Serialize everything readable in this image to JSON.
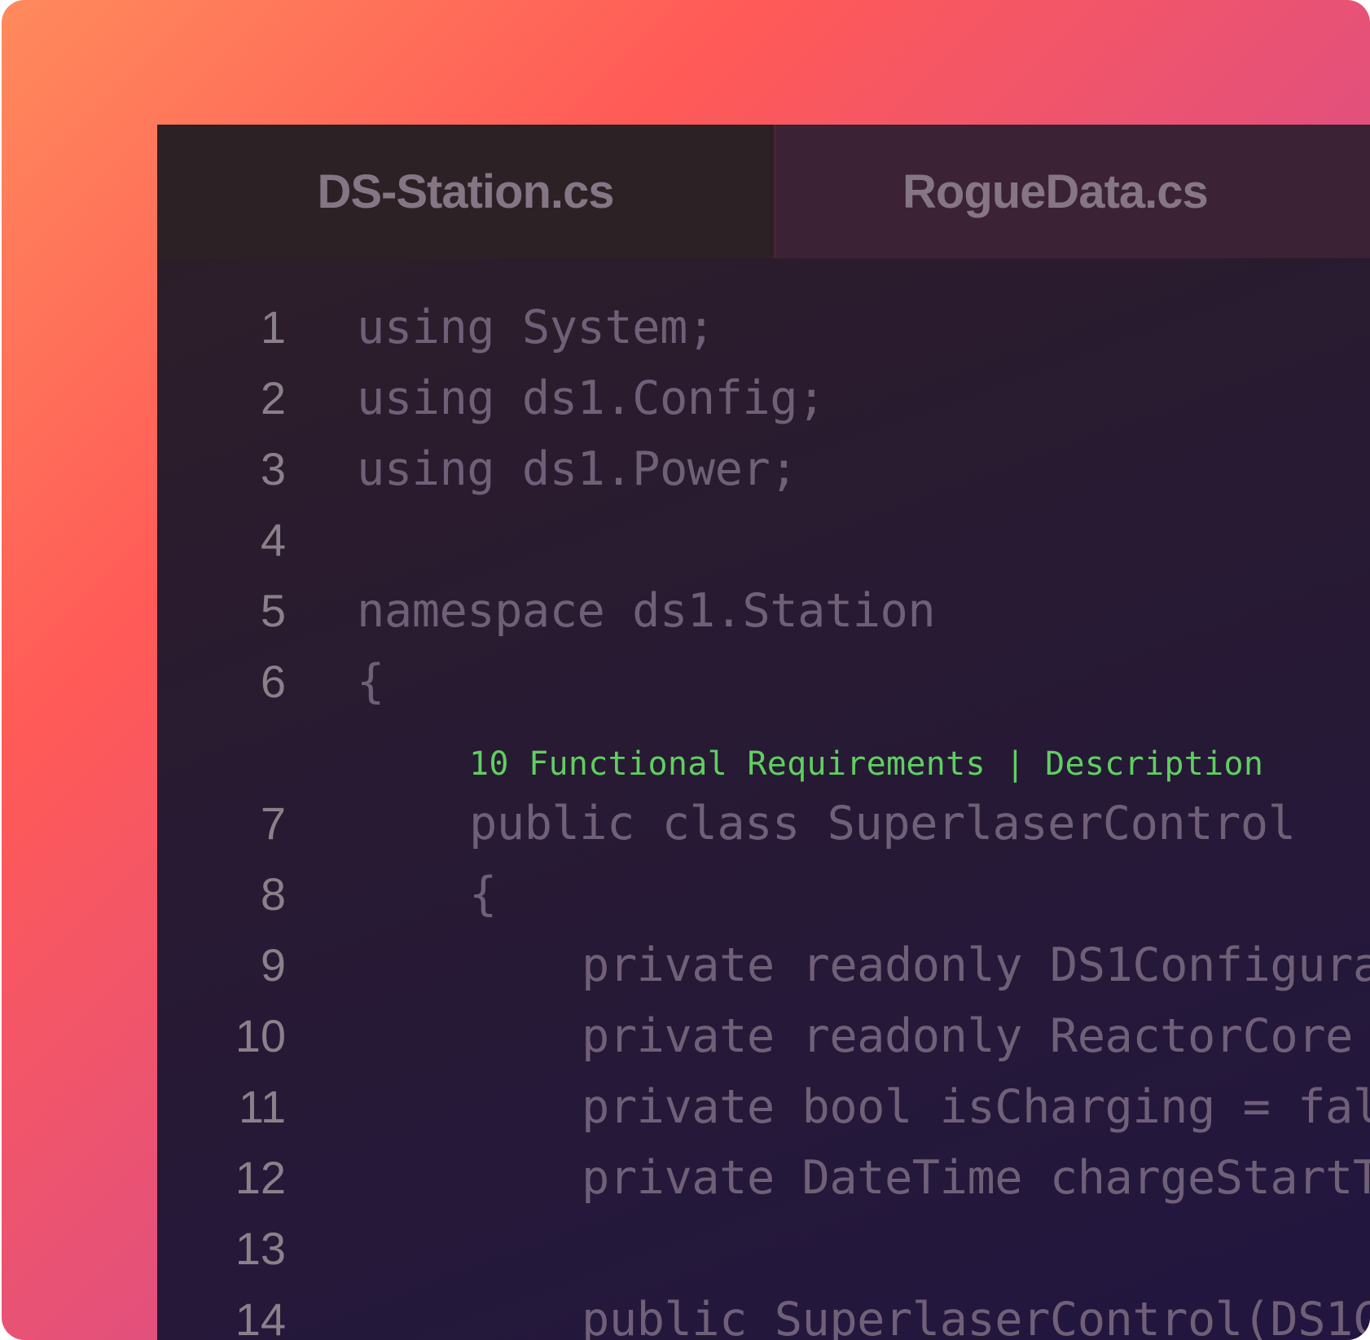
{
  "tabs": [
    {
      "label": "DS-Station.cs"
    },
    {
      "label": "RogueData.cs"
    }
  ],
  "code_lines": [
    {
      "number": "1",
      "text": "using System;"
    },
    {
      "number": "2",
      "text": "using ds1.Config;"
    },
    {
      "number": "3",
      "text": "using ds1.Power;"
    },
    {
      "number": "4",
      "text": ""
    },
    {
      "number": "5",
      "text": "namespace ds1.Station"
    },
    {
      "number": "6",
      "text": "{"
    },
    {
      "number": "7",
      "text": "public class SuperlaserControl"
    },
    {
      "number": "8",
      "text": "{"
    },
    {
      "number": "9",
      "text": "private readonly DS1Configura"
    },
    {
      "number": "10",
      "text": "private readonly ReactorCore"
    },
    {
      "number": "11",
      "text": "private bool isCharging = fal"
    },
    {
      "number": "12",
      "text": "private DateTime chargeStartT"
    },
    {
      "number": "13",
      "text": ""
    },
    {
      "number": "14",
      "text": "public SuperlaserControl(DS1C"
    }
  ],
  "codelens": {
    "text": "10 Functional Requirements | Description"
  },
  "colors": {
    "background_gradient_start": "#ff8a5c",
    "background_gradient_mid": "#ff5a57",
    "background_gradient_end": "#a82cbf",
    "editor_bg": "#261a35",
    "code_text": "#6f6078",
    "line_number": "#8a8089",
    "codelens": "#5fcf5f",
    "tab_text": "#857585"
  }
}
